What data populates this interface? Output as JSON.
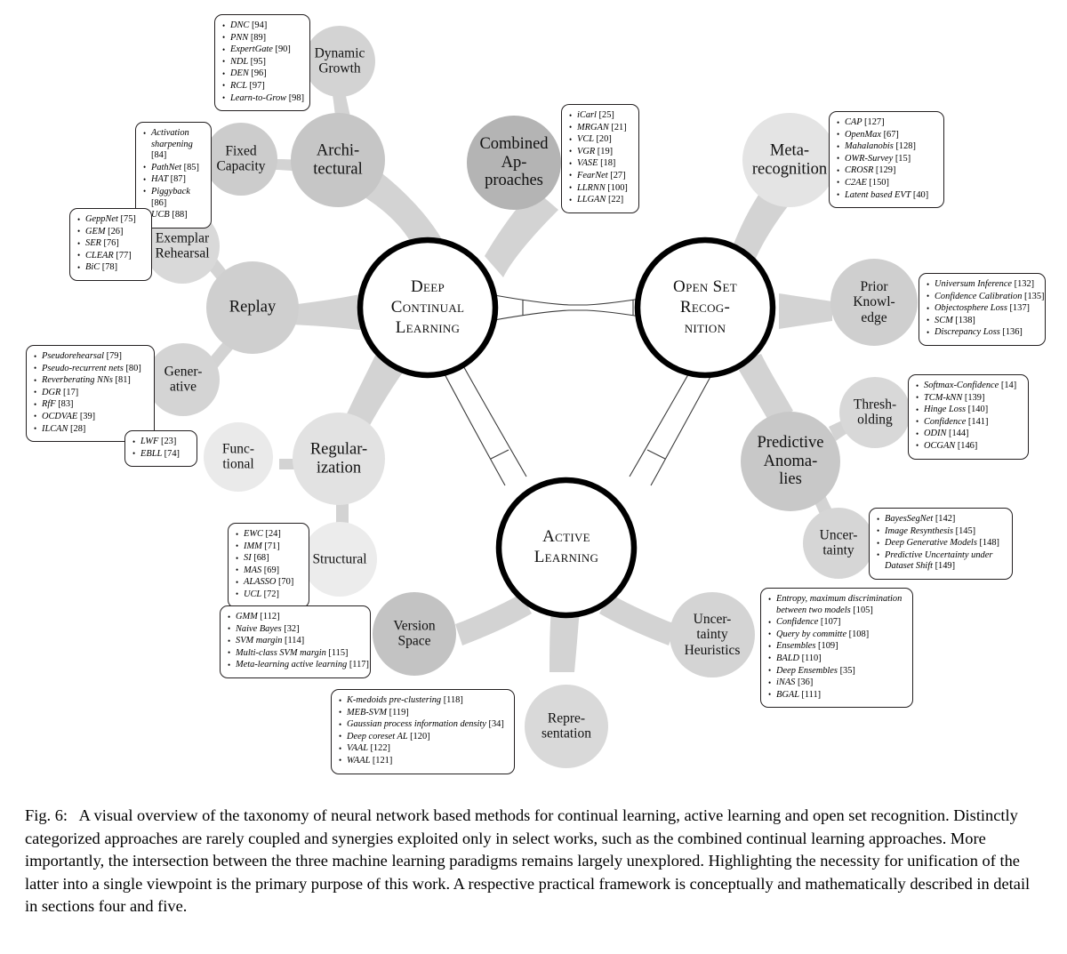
{
  "figure": {
    "caption_label": "Fig. 6:",
    "caption_text": "A visual overview of the taxonomy of neural network based methods for continual learning, active learning and open set recognition. Distinctly categorized approaches are rarely coupled and synergies exploited only in select works, such as the combined continual learning approaches. More importantly, the intersection between the three machine learning paradigms remains largely unexplored. Highlighting the necessity for unification of the latter into a single viewpoint is the primary purpose of this work. A respective practical framework is conceptually and mathematically described in detail in sections four and five."
  },
  "colors": {
    "hub_stroke": "#000000",
    "hub_fill": "#ffffff",
    "level1_fill": "#c9c9c9",
    "level1_dark_fill": "#a8a8a8",
    "level2_fill": "#d6d6d6",
    "level2_light_fill": "#e6e6e6",
    "box_border": "#231f20",
    "box_fill": "#ffffff",
    "bridge_stroke": "#3c3c3c"
  },
  "hubs": [
    {
      "id": "deep-continual-learning",
      "label": "Deep\nContinual\nLearning"
    },
    {
      "id": "open-set-recognition",
      "label": "Open Set\nRecog-\nnition"
    },
    {
      "id": "active-learning",
      "label": "Active\nLearning"
    }
  ],
  "nodes": [
    {
      "id": "architectural",
      "label": "Archi-\ntectural"
    },
    {
      "id": "dynamic-growth",
      "label": "Dynamic\nGrowth"
    },
    {
      "id": "fixed-capacity",
      "label": "Fixed\nCapacity"
    },
    {
      "id": "combined-approaches",
      "label": "Combined\nAp-\nproaches"
    },
    {
      "id": "replay",
      "label": "Replay"
    },
    {
      "id": "exemplar-rehearsal",
      "label": "Exemplar\nRehearsal"
    },
    {
      "id": "generative",
      "label": "Gener-\native"
    },
    {
      "id": "regularization",
      "label": "Regular-\nization"
    },
    {
      "id": "functional",
      "label": "Func-\ntional"
    },
    {
      "id": "structural",
      "label": "Structural"
    },
    {
      "id": "meta-recognition",
      "label": "Meta-\nrecognition"
    },
    {
      "id": "prior-knowledge",
      "label": "Prior\nKnowl-\nedge"
    },
    {
      "id": "predictive-anomalies",
      "label": "Predictive\nAnoma-\nlies"
    },
    {
      "id": "thresholding",
      "label": "Thresh-\nolding"
    },
    {
      "id": "uncertainty",
      "label": "Uncer-\ntainty"
    },
    {
      "id": "version-space",
      "label": "Version\nSpace"
    },
    {
      "id": "representation",
      "label": "Repre-\nsentation"
    },
    {
      "id": "uncertainty-heuristics",
      "label": "Uncer-\ntainty\nHeuristics"
    }
  ],
  "reference_boxes": {
    "dynamic_growth": [
      {
        "name": "DNC",
        "ref": "[94]"
      },
      {
        "name": "PNN",
        "ref": "[89]"
      },
      {
        "name": "ExpertGate",
        "ref": "[90]"
      },
      {
        "name": "NDL",
        "ref": "[95]"
      },
      {
        "name": "DEN",
        "ref": "[96]"
      },
      {
        "name": "RCL",
        "ref": "[97]"
      },
      {
        "name": "Learn-to-Grow",
        "ref": "[98]"
      }
    ],
    "fixed_capacity": [
      {
        "name": "Activation sharpening",
        "ref": "[84]"
      },
      {
        "name": "PathNet",
        "ref": "[85]"
      },
      {
        "name": "HAT",
        "ref": "[87]"
      },
      {
        "name": "Piggyback",
        "ref": "[86]"
      },
      {
        "name": "UCB",
        "ref": "[88]"
      }
    ],
    "combined_approaches": [
      {
        "name": "iCarl",
        "ref": "[25]"
      },
      {
        "name": "MRGAN",
        "ref": "[21]"
      },
      {
        "name": "VCL",
        "ref": "[20]"
      },
      {
        "name": "VGR",
        "ref": "[19]"
      },
      {
        "name": "VASE",
        "ref": "[18]"
      },
      {
        "name": "FearNet",
        "ref": "[27]"
      },
      {
        "name": "LLRNN",
        "ref": "[100]"
      },
      {
        "name": "LLGAN",
        "ref": "[22]"
      }
    ],
    "exemplar_rehearsal": [
      {
        "name": "GeppNet",
        "ref": "[75]"
      },
      {
        "name": "GEM",
        "ref": "[26]"
      },
      {
        "name": "SER",
        "ref": "[76]"
      },
      {
        "name": "CLEAR",
        "ref": "[77]"
      },
      {
        "name": "BiC",
        "ref": "[78]"
      }
    ],
    "generative": [
      {
        "name": "Pseudorehearsal",
        "ref": "[79]"
      },
      {
        "name": "Pseudo-recurrent nets",
        "ref": "[80]"
      },
      {
        "name": "Reverberating NNs",
        "ref": "[81]"
      },
      {
        "name": "DGR",
        "ref": "[17]"
      },
      {
        "name": "RfF",
        "ref": "[83]"
      },
      {
        "name": "OCDVAE",
        "ref": "[39]"
      },
      {
        "name": "ILCAN",
        "ref": "[28]"
      }
    ],
    "functional": [
      {
        "name": "LWF",
        "ref": "[23]"
      },
      {
        "name": "EBLL",
        "ref": "[74]"
      }
    ],
    "structural": [
      {
        "name": "EWC",
        "ref": "[24]"
      },
      {
        "name": "IMM",
        "ref": "[71]"
      },
      {
        "name": "SI",
        "ref": "[68]"
      },
      {
        "name": "MAS",
        "ref": "[69]"
      },
      {
        "name": "ALASSO",
        "ref": "[70]"
      },
      {
        "name": "UCL",
        "ref": "[72]"
      }
    ],
    "meta_recognition": [
      {
        "name": "CAP",
        "ref": "[127]"
      },
      {
        "name": "OpenMax",
        "ref": "[67]"
      },
      {
        "name": "Mahalanobis",
        "ref": "[128]"
      },
      {
        "name": "OWR-Survey",
        "ref": "[15]"
      },
      {
        "name": "CROSR",
        "ref": "[129]"
      },
      {
        "name": "C2AE",
        "ref": "[150]"
      },
      {
        "name": "Latent based EVT",
        "ref": "[40]"
      }
    ],
    "prior_knowledge": [
      {
        "name": "Universum Inference",
        "ref": "[132]"
      },
      {
        "name": "Confidence Calibration",
        "ref": "[135]"
      },
      {
        "name": "Objectosphere Loss",
        "ref": "[137]"
      },
      {
        "name": "SCM",
        "ref": "[138]"
      },
      {
        "name": "Discrepancy Loss",
        "ref": "[136]"
      }
    ],
    "thresholding": [
      {
        "name": "Softmax-Confidence",
        "ref": "[14]"
      },
      {
        "name": "TCM-kNN",
        "ref": "[139]"
      },
      {
        "name": "Hinge Loss",
        "ref": "[140]"
      },
      {
        "name": "Confidence",
        "ref": "[141]"
      },
      {
        "name": "ODIN",
        "ref": "[144]"
      },
      {
        "name": "OCGAN",
        "ref": "[146]"
      }
    ],
    "uncertainty": [
      {
        "name": "BayesSegNet",
        "ref": "[142]"
      },
      {
        "name": "Image Resynthesis",
        "ref": "[145]"
      },
      {
        "name": "Deep Generative Models",
        "ref": "[148]"
      },
      {
        "name": "Predictive Uncertainty under Dataset Shift",
        "ref": "[149]"
      }
    ],
    "version_space": [
      {
        "name": "GMM",
        "ref": "[112]"
      },
      {
        "name": "Naive Bayes",
        "ref": "[32]"
      },
      {
        "name": "SVM margin",
        "ref": "[114]"
      },
      {
        "name": "Multi-class SVM margin",
        "ref": "[115]"
      },
      {
        "name": "Meta-learning active learning",
        "ref": "[117]"
      }
    ],
    "representation": [
      {
        "name": "K-medoids pre-clustering",
        "ref": "[118]"
      },
      {
        "name": "MEB-SVM",
        "ref": "[119]"
      },
      {
        "name": "Gaussian process information density",
        "ref": "[34]"
      },
      {
        "name": "Deep coreset AL",
        "ref": "[120]"
      },
      {
        "name": "VAAL",
        "ref": "[122]"
      },
      {
        "name": "WAAL",
        "ref": "[121]"
      }
    ],
    "uncertainty_heuristics": [
      {
        "name": "Entropy, maximum discrimination between two models",
        "ref": "[105]"
      },
      {
        "name": "Confidence",
        "ref": "[107]"
      },
      {
        "name": "Query by committe",
        "ref": "[108]"
      },
      {
        "name": "Ensembles",
        "ref": "[109]"
      },
      {
        "name": "BALD",
        "ref": "[110]"
      },
      {
        "name": "Deep Ensembles",
        "ref": "[35]"
      },
      {
        "name": "iNAS",
        "ref": "[36]"
      },
      {
        "name": "BGAL",
        "ref": "[111]"
      }
    ]
  }
}
